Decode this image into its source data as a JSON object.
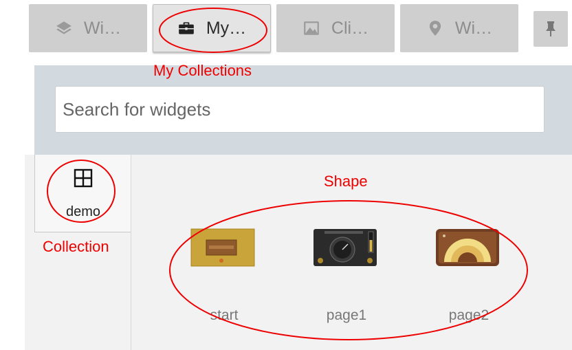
{
  "tabs": [
    {
      "label": "Wi…",
      "icon": "layers-icon"
    },
    {
      "label": "My…",
      "icon": "briefcase-icon"
    },
    {
      "label": "Cli…",
      "icon": "image-icon"
    },
    {
      "label": "Wi…",
      "icon": "map-pin-icon"
    }
  ],
  "pin_icon": "pin-icon",
  "search": {
    "placeholder": "Search for widgets"
  },
  "collection": {
    "label": "demo",
    "icon": "grid-icon"
  },
  "widgets": [
    {
      "label": "start"
    },
    {
      "label": "page1"
    },
    {
      "label": "page2"
    }
  ],
  "annotations": {
    "my_collections": "My Collections",
    "collection": "Collection",
    "shape": "Shape",
    "color": "#ee0000"
  }
}
